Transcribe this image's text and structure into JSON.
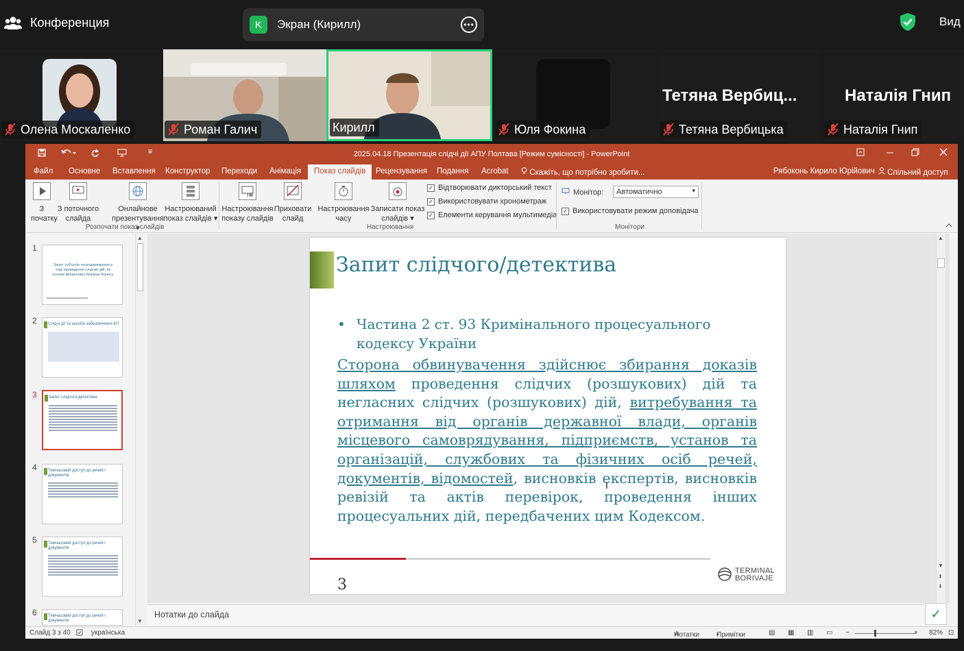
{
  "zoom": {
    "conference_label": "Конференция",
    "share_avatar_letter": "K",
    "share_label": "Экран (Кирилл)",
    "more_glyph": "•••",
    "view_label": "Вид",
    "colors": {
      "active_border": "#27d27a",
      "share_badge": "#22b55a",
      "mic_muted": "#e0403a"
    },
    "participants": [
      {
        "name": "Олена Москаленко",
        "muted": true
      },
      {
        "name": "Роман Галич",
        "muted": true
      },
      {
        "name": "Кирилл",
        "muted": false,
        "active": true
      },
      {
        "name": "Юля Фокина",
        "muted": true
      },
      {
        "name": "Тетяна Вербицька",
        "big_name": "Тетяна  Вербиц...",
        "muted": true
      },
      {
        "name": "Наталія Гнип",
        "big_name": "Наталія Гнип",
        "muted": true
      }
    ]
  },
  "ppt": {
    "title": "2025.04.18 Презентація слідчі дії АПУ Полтава [Режим сумісності] - PowerPoint",
    "tabs": [
      "Файл",
      "Основне",
      "Вставлення",
      "Конструктор",
      "Переходи",
      "Анімація",
      "Показ слайдів",
      "Рецензування",
      "Подання",
      "Acrobat"
    ],
    "active_tab": "Показ слайдів",
    "tell_me": "Скажіть, що потрібно зробити...",
    "user": "Рябоконь Кирило Юрійович",
    "share": "Спільний доступ",
    "ribbon": {
      "from_start": [
        "З",
        "початку"
      ],
      "from_current": [
        "З поточного",
        "слайда"
      ],
      "online": [
        "Онлайнове",
        "презентування"
      ],
      "custom": [
        "Настроюваний",
        "показ слайдів"
      ],
      "group_start": "Розпочати показ слайдів",
      "setup": [
        "Настроювання",
        "показу слайдів"
      ],
      "hide": [
        "Приховати",
        "слайд"
      ],
      "rehearse": [
        "Настроювання",
        "часу"
      ],
      "record": [
        "Записати показ",
        "слайдів"
      ],
      "chk_narration": "Відтворювати дикторський текст",
      "chk_timings": "Використовувати хронометраж",
      "chk_media": "Елементи керування мультимедіа",
      "group_setup": "Настроювання",
      "monitor_label": "Монітор:",
      "monitor_value": "Автоматично",
      "chk_presenter": "Використовувати режим доповідача",
      "group_monitors": "Монітори"
    },
    "thumbnails": [
      {
        "num": "1",
        "title": "Запит суб'єктів господарювання в ході проведення слідчих дій, як основи фінансової безпеки бізнесу"
      },
      {
        "num": "2",
        "title": "Слідчі дії та засоби забезпечення КП"
      },
      {
        "num": "3",
        "title": "Запит слідчого/детектива",
        "selected": true
      },
      {
        "num": "4",
        "title": "Тимчасовий доступ до речей і документів"
      },
      {
        "num": "5",
        "title": "Тимчасовий доступ до речей і документів"
      },
      {
        "num": "6",
        "title": "Тимчасовий доступ до речей і документів"
      }
    ],
    "slide": {
      "title": "Запит слідчого/детектива",
      "bullet": "Частина 2 ст. 93 Кримінального процесуального кодексу України",
      "body": [
        {
          "text": "Сторона обвинувачення здійснює збирання доказів шляхом",
          "u": true
        },
        {
          "text": " проведення слідчих (розшукових) дій та негласних слідчих (розшукових) дій, ",
          "u": false
        },
        {
          "text": "витребування та отримання від органів державної влади, органів місцевого самоврядування, підприємств, установ та організацій, службових та фізичних осіб речей, документів, відомостей",
          "u": true
        },
        {
          "text": ", висновків експертів, висновків ревізій та актів перевірок, проведення інших процесуальних дій, передбачених цим Кодексом.",
          "u": false
        }
      ],
      "number": "3",
      "logo_line1": "TERMINAL",
      "logo_line2": "BORIVAJE",
      "colors": {
        "text": "#2e7a8c",
        "accent_dark": "#5a7a24",
        "accent_light": "#b2c86a",
        "footer_red": "#c0253a"
      }
    },
    "notes_placeholder": "Нотатки до слайда",
    "status": {
      "slide_info": "Слайд 3 з 40",
      "language": "українська",
      "notes": "Нотатки",
      "comments": "Примітки",
      "zoom": "82%"
    },
    "colors": {
      "brand": "#b7472a",
      "selected_thumb": "#d0432a"
    }
  }
}
